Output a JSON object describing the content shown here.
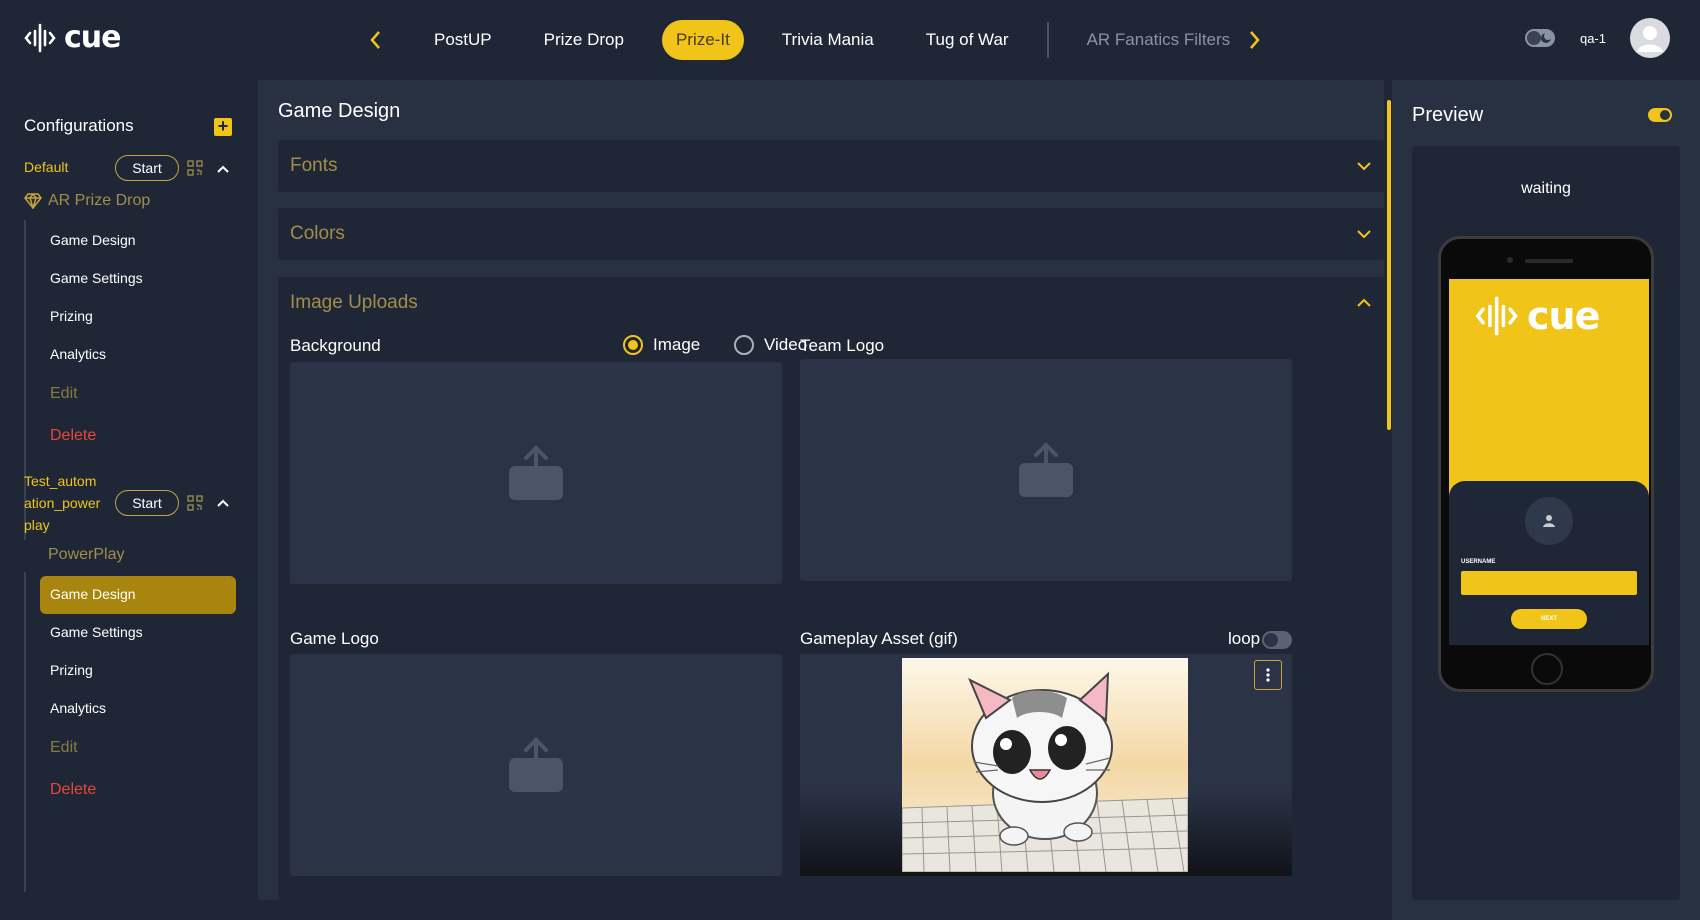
{
  "brand": {
    "logo_text": "cue"
  },
  "nav": {
    "tabs": [
      "PostUP",
      "Prize Drop",
      "Prize-It",
      "Trivia Mania",
      "Tug of War",
      "AR Fanatics Filters"
    ],
    "active_index": 2
  },
  "user": {
    "name": "qa-1"
  },
  "sidebar": {
    "title": "Configurations",
    "configs": [
      {
        "name": "Default",
        "start_label": "Start",
        "game_type": "AR Prize Drop",
        "items": [
          "Game Design",
          "Game Settings",
          "Prizing",
          "Analytics"
        ],
        "edit_label": "Edit",
        "delete_label": "Delete"
      },
      {
        "name_lines": [
          "Test_autom",
          "ation_power",
          "play"
        ],
        "start_label": "Start",
        "game_type": "PowerPlay",
        "items": [
          "Game Design",
          "Game Settings",
          "Prizing",
          "Analytics"
        ],
        "active_item": "Game Design",
        "edit_label": "Edit",
        "delete_label": "Delete"
      }
    ]
  },
  "main": {
    "title": "Game Design",
    "sections": {
      "fonts": "Fonts",
      "colors": "Colors",
      "image_uploads": "Image Uploads"
    },
    "uploads": {
      "background_label": "Background",
      "radio_image": "Image",
      "radio_video": "Video",
      "selected_radio": "Image",
      "team_logo_label": "Team Logo",
      "game_logo_label": "Game Logo",
      "gameplay_asset_label": "Gameplay Asset (gif)",
      "loop_label": "loop"
    }
  },
  "preview": {
    "title": "Preview",
    "status": "waiting",
    "phone": {
      "logo_text": "cue",
      "field_label": "USERNAME",
      "button_label": "NEXT"
    }
  },
  "colors": {
    "accent": "#f0c419",
    "background": "#1f2737",
    "panel": "#273142",
    "danger": "#e8463a"
  }
}
